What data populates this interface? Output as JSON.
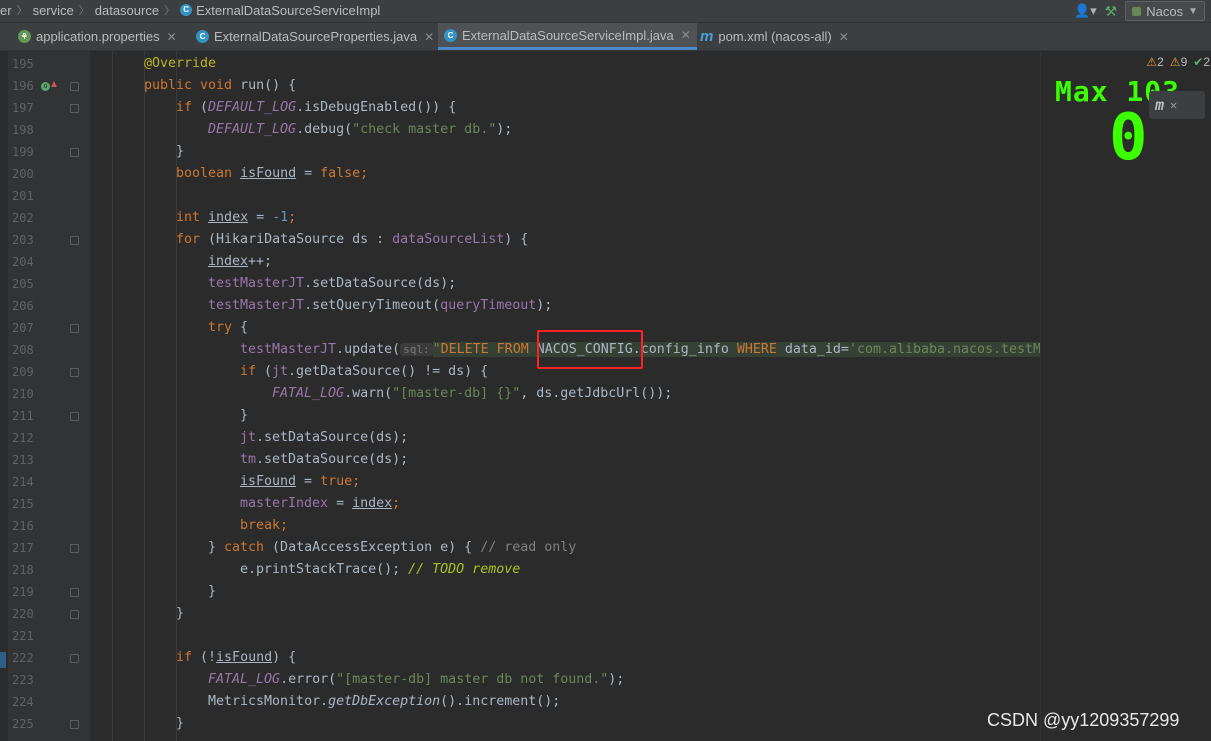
{
  "navbar": {
    "breadcrumbs": [
      "er",
      "service",
      "datasource",
      "ExternalDataSourceServiceImpl"
    ],
    "run_config": "Nacos"
  },
  "tabs": [
    {
      "label": "application.properties",
      "icon": "leaf-icon",
      "active": false
    },
    {
      "label": "ExternalDataSourceProperties.java",
      "icon": "class-icon",
      "active": false
    },
    {
      "label": "ExternalDataSourceServiceImpl.java",
      "icon": "class-icon",
      "active": true
    },
    {
      "label": "pom.xml (nacos-all)",
      "icon": "maven-icon",
      "active": false
    }
  ],
  "inspections": {
    "warnings": "2",
    "weak_warnings": "9",
    "ok": "2"
  },
  "overlay": {
    "max_label": "Max 103",
    "value": "0"
  },
  "watermark": "CSDN @yy1209357299",
  "code": {
    "line_numbers": [
      "195",
      "196",
      "197",
      "198",
      "199",
      "200",
      "201",
      "202",
      "203",
      "204",
      "205",
      "206",
      "207",
      "208",
      "209",
      "210",
      "211",
      "212",
      "213",
      "214",
      "215",
      "216",
      "217",
      "218",
      "219",
      "220",
      "221",
      "222",
      "223",
      "224",
      "225"
    ],
    "l195": {
      "a": "@Override"
    },
    "l196": {
      "k": "public void",
      "t": " run() {"
    },
    "l197": {
      "k": "if",
      "t1": " (",
      "s": "DEFAULT_LOG",
      "t2": ".isDebugEnabled()) {"
    },
    "l198": {
      "s": "DEFAULT_LOG",
      "t1": ".debug(",
      "str": "\"check master db.\"",
      "t2": ");"
    },
    "l199": {
      "t": "}"
    },
    "l200": {
      "k": "boolean",
      "t1": " ",
      "u": "isFound",
      "t2": " = ",
      "k2": "false",
      "t3": ";"
    },
    "l202": {
      "k": "int",
      "t1": " ",
      "u": "index",
      "t2": " = ",
      "n": "-1",
      "t3": ";"
    },
    "l203": {
      "k": "for",
      "t1": " (HikariDataSource ds : ",
      "f": "dataSourceList",
      "t2": ") {"
    },
    "l204": {
      "u": "index",
      "t": "++;"
    },
    "l205": {
      "f": "testMasterJT",
      "t": ".setDataSource(ds);"
    },
    "l206": {
      "f": "testMasterJT",
      "t1": ".setQueryTimeout(",
      "f2": "queryTimeout",
      "t2": ");"
    },
    "l207": {
      "k": "try",
      "t": " {"
    },
    "l208": {
      "f": "testMasterJT",
      "t1": ".update(",
      "hint": "sql:",
      "q1": "\"",
      "sq1": "DELETE FROM",
      "sq2": " NACOS_CONFIG.config_info ",
      "sq3": "WHERE",
      "sq4": " data_id=",
      "sq5": "'com.alibaba.nacos.testMasterDB'",
      "q2": "\"",
      "t2": ");"
    },
    "l209": {
      "k": "if",
      "t1": " (",
      "f": "jt",
      "t2": ".getDataSource() != ds) {"
    },
    "l210": {
      "s": "FATAL_LOG",
      "t1": ".warn(",
      "str": "\"[master-db] {}\"",
      "t2": ", ds.getJdbcUrl());"
    },
    "l211": {
      "t": "}"
    },
    "l212": {
      "f": "jt",
      "t": ".setDataSource(ds);"
    },
    "l213": {
      "f": "tm",
      "t": ".setDataSource(ds);"
    },
    "l214": {
      "u": "isFound",
      "t1": " = ",
      "k": "true",
      "t2": ";"
    },
    "l215": {
      "f": "masterIndex",
      "t1": " = ",
      "u": "index",
      "t2": ";"
    },
    "l216": {
      "k": "break",
      "t": ";"
    },
    "l217": {
      "t1": "} ",
      "k": "catch",
      "t2": " (DataAccessException e) { ",
      "c": "// read only"
    },
    "l218": {
      "t": "e.printStackTrace(); ",
      "c": "// ",
      "todo": "TODO remove"
    },
    "l219": {
      "t": "}"
    },
    "l220": {
      "t": "}"
    },
    "l222": {
      "k": "if",
      "t1": " (!",
      "u": "isFound",
      "t2": ") {"
    },
    "l223": {
      "s": "FATAL_LOG",
      "t1": ".error(",
      "str": "\"[master-db] master db not found.\"",
      "t2": ");"
    },
    "l224": {
      "t1": "MetricsMonitor.",
      "i": "getDbException",
      "t2": "().increment();"
    },
    "l225": {
      "t": "}"
    }
  }
}
